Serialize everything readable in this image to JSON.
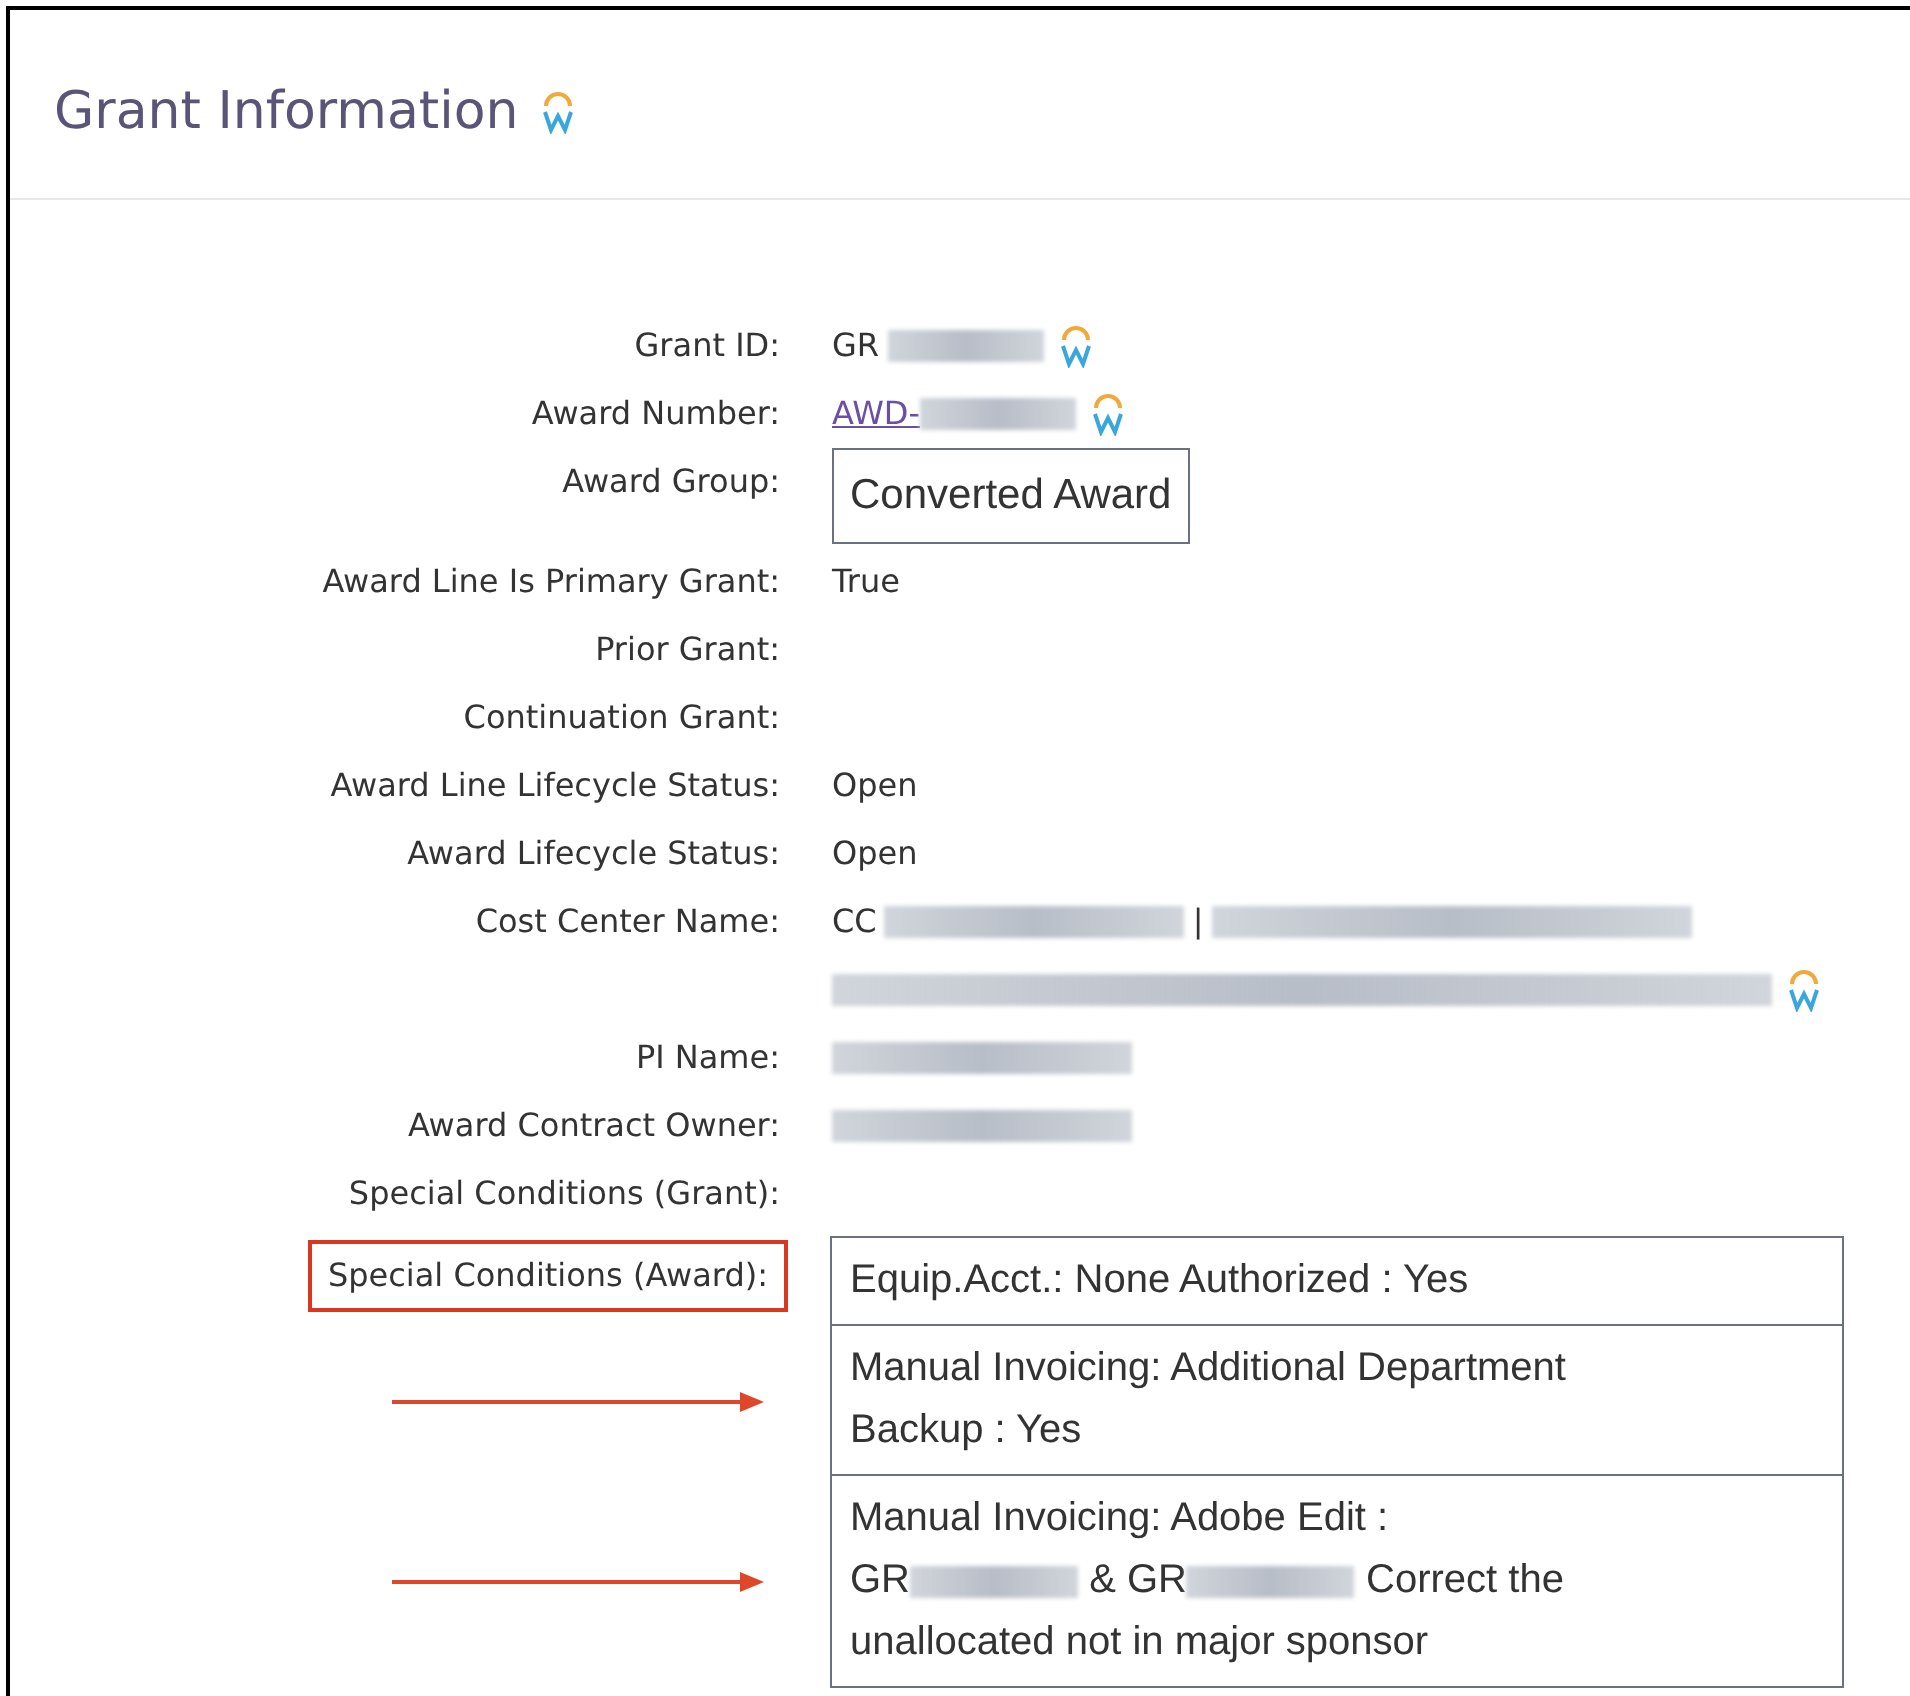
{
  "title": "Grant Information",
  "title_icon": true,
  "fields": [
    {
      "label": "Grant ID:",
      "kind": "text",
      "icon": true,
      "lines": [
        [
          {
            "kind": "text",
            "text": "GR"
          },
          {
            "kind": "redacted"
          }
        ]
      ]
    },
    {
      "label": "Award Number:",
      "kind": "link",
      "icon": true,
      "lines": [
        [
          {
            "kind": "text",
            "text": "AWD-"
          },
          {
            "kind": "redacted"
          }
        ]
      ]
    },
    {
      "label": "Award Group:",
      "kind": "boxed",
      "lines": [
        [
          {
            "kind": "text",
            "text": "Converted Award"
          }
        ]
      ]
    },
    {
      "label": "Award Line Is Primary Grant:",
      "kind": "text",
      "lines": [
        [
          {
            "kind": "text",
            "text": "True"
          }
        ]
      ]
    },
    {
      "label": "Prior Grant:"
    },
    {
      "label": "Continuation Grant:"
    },
    {
      "label": "Award Line Lifecycle Status:",
      "kind": "text",
      "lines": [
        [
          {
            "kind": "text",
            "text": "Open"
          }
        ]
      ]
    },
    {
      "label": "Award Lifecycle Status:",
      "kind": "text",
      "lines": [
        [
          {
            "kind": "text",
            "text": "Open"
          }
        ]
      ]
    },
    {
      "label": "Cost Center Name:",
      "kind": "text",
      "icon": true,
      "lines": [
        [
          {
            "kind": "text",
            "text": "CC"
          },
          {
            "kind": "redacted"
          },
          {
            "kind": "text",
            "text": "|"
          },
          {
            "kind": "redacted"
          }
        ],
        [
          {
            "kind": "redacted"
          }
        ]
      ]
    },
    {
      "label": "PI Name:",
      "kind": "text",
      "lines": [
        [
          {
            "kind": "redacted"
          }
        ]
      ]
    },
    {
      "label": "Award Contract Owner:",
      "kind": "text",
      "lines": [
        [
          {
            "kind": "redacted"
          }
        ]
      ]
    },
    {
      "label": "Special Conditions (Grant):"
    }
  ],
  "award_conditions": {
    "label": "Special Conditions (Award):",
    "highlighted": true,
    "items": [
      {
        "segments": [
          {
            "kind": "text",
            "text": "Equip.Acct.: None Authorized : Yes"
          }
        ]
      },
      {
        "arrow": true,
        "segments": [
          {
            "kind": "text",
            "text": "Manual Invoicing: Additional Department Backup : Yes"
          }
        ]
      },
      {
        "arrow": true,
        "segments": [
          {
            "kind": "text",
            "text": "Manual Invoicing: Adobe Edit :"
          },
          {
            "kind": "text",
            "text": "GR"
          },
          {
            "kind": "redacted"
          },
          {
            "kind": "text",
            "text": "& GR"
          },
          {
            "kind": "redacted"
          },
          {
            "kind": "text",
            "text": "Correct the unallocated not in major sponsor"
          }
        ]
      }
    ]
  }
}
